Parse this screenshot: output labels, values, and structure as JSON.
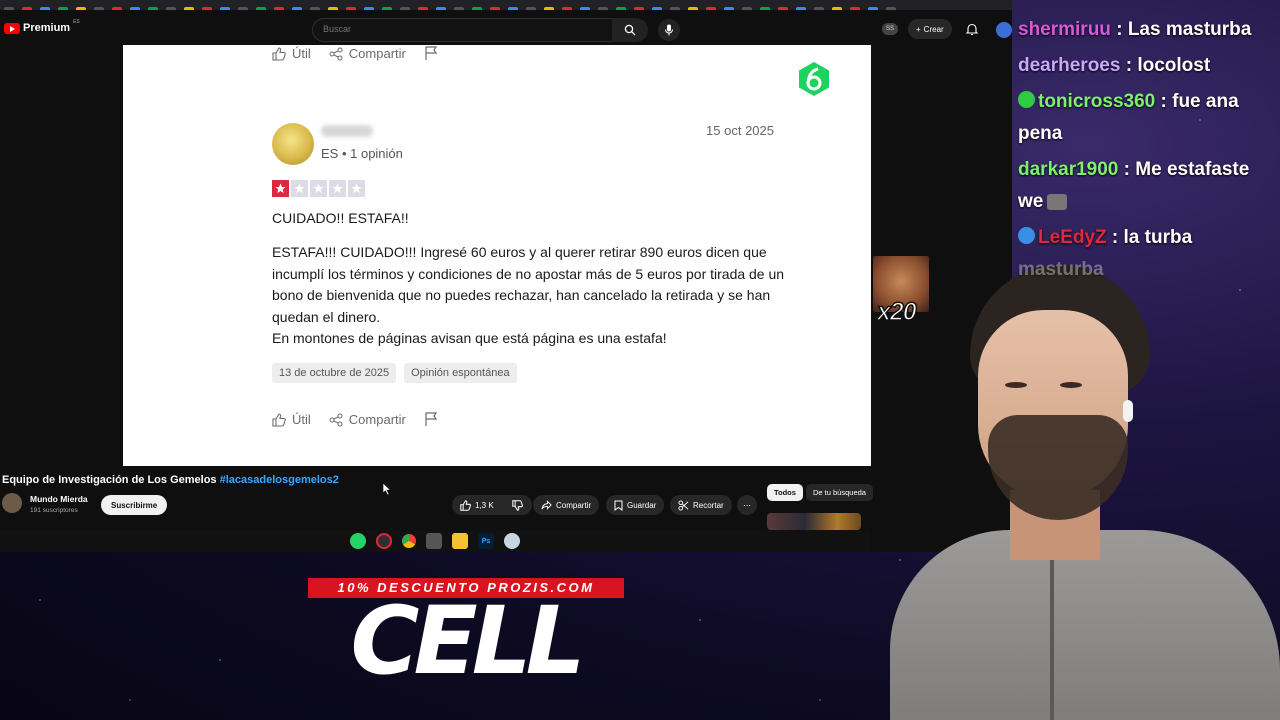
{
  "browser": {
    "logo_text": "Premium",
    "logo_sup": "ES",
    "search_placeholder": "Buscar",
    "ss_badge": "SS",
    "create_label": "Crear"
  },
  "review_page": {
    "top_actions": {
      "useful": "Útil",
      "share": "Compartir"
    },
    "reviewer_meta": "ES • 1 opinión",
    "date": "15 oct 2025",
    "rating": 1,
    "rating_max": 5,
    "title": "CUIDADO!! ESTAFA!!",
    "body_lines": [
      "ESTAFA!!! CUIDADO!!! Ingresé 60 euros y al querer retirar 890 euros dicen que incumplí los términos y condiciones de no apostar más de 5 euros por tirada de un bono de bienvenida que no puedes rechazar, han cancelado la retirada y se han quedan el dinero.",
      "En montones de páginas avisan que está página es una estafa!"
    ],
    "chips": [
      "13 de octubre de 2025",
      "Opinión espontánea"
    ],
    "bottom_actions": {
      "useful": "Útil",
      "share": "Compartir"
    }
  },
  "video": {
    "title": "Equipo de Investigación de Los Gemelos",
    "hashtag": "#lacasadelosgemelos2",
    "channel": "Mundo Mierda",
    "subscribers": "191 suscriptores",
    "subscribe": "Suscribirme",
    "likes": "1,3 K",
    "share": "Compartir",
    "save": "Guardar",
    "clip": "Recortar",
    "filters": [
      "Todos",
      "De tu búsqueda"
    ]
  },
  "taskbar": {
    "icons": [
      "whatsapp-icon",
      "obs-icon",
      "chrome-icon",
      "app-icon",
      "folder-icon",
      "photoshop-icon",
      "steam-icon"
    ],
    "ps_label": "Ps"
  },
  "chat": [
    {
      "user": "shermiruu",
      "color": "#d65ad8",
      "message": "Las masturba"
    },
    {
      "user": "dearheroes",
      "color": "#c9a8ff",
      "message": "locolost"
    },
    {
      "user": "tonicross360",
      "color": "#7cf26a",
      "message": "fue ana"
    },
    {
      "user": "",
      "color": "#ffffff",
      "message": "pena"
    },
    {
      "user": "darkar1900",
      "color": "#7cf26a",
      "message": "Me estafaste"
    },
    {
      "user": "",
      "color": "#ffffff",
      "message": "we"
    },
    {
      "user": "LeEdyZ",
      "color": "#e0283c",
      "message": "la turba"
    },
    {
      "user": "",
      "color": "#ffffff",
      "message": "masturba"
    }
  ],
  "emote_overlay": {
    "count": "x20"
  },
  "promo": {
    "strip": "10% DESCUENTO PROZIS.COM",
    "big": "CELL"
  },
  "colors": {
    "star_on": "#e0283c",
    "link_blue": "#3ea6ff",
    "yt_red": "#ff0000",
    "six_green": "#1dd35f"
  }
}
